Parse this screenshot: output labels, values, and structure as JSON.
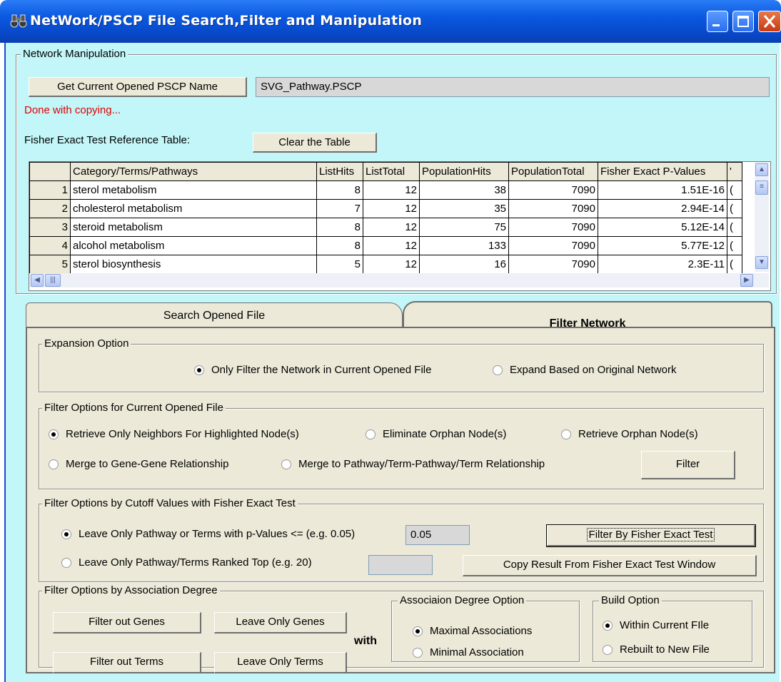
{
  "window": {
    "title": "NetWork/PSCP File Search,Filter and Manipulation",
    "app_icon": "binoculars-icon"
  },
  "network_manipulation": {
    "legend": "Network Manipulation",
    "get_name_button": "Get Current Opened PSCP Name",
    "pscp_name_value": "SVG_Pathway.PSCP",
    "status_text": "Done with copying...",
    "fisher_table_label": "Fisher Exact Test Reference Table:",
    "clear_table_button": "Clear the Table"
  },
  "fisher_table": {
    "columns": [
      "Category/Terms/Pathways",
      "ListHits",
      "ListTotal",
      "PopulationHits",
      "PopulationTotal",
      "Fisher Exact P-Values",
      "'"
    ],
    "rows": [
      {
        "index": "1",
        "term": "sterol metabolism",
        "list_hits": "8",
        "list_total": "12",
        "pop_hits": "38",
        "pop_total": "7090",
        "p_value": "1.51E-16",
        "extra": "("
      },
      {
        "index": "2",
        "term": "cholesterol metabolism",
        "list_hits": "7",
        "list_total": "12",
        "pop_hits": "35",
        "pop_total": "7090",
        "p_value": "2.94E-14",
        "extra": "("
      },
      {
        "index": "3",
        "term": "steroid metabolism",
        "list_hits": "8",
        "list_total": "12",
        "pop_hits": "75",
        "pop_total": "7090",
        "p_value": "5.12E-14",
        "extra": "("
      },
      {
        "index": "4",
        "term": "alcohol metabolism",
        "list_hits": "8",
        "list_total": "12",
        "pop_hits": "133",
        "pop_total": "7090",
        "p_value": "5.77E-12",
        "extra": "("
      },
      {
        "index": "5",
        "term": "sterol biosynthesis",
        "list_hits": "5",
        "list_total": "12",
        "pop_hits": "16",
        "pop_total": "7090",
        "p_value": "2.3E-11",
        "extra": "("
      }
    ]
  },
  "tabs": {
    "search": "Search Opened File",
    "filter": "Filter Network"
  },
  "expansion": {
    "legend": "Expansion Option",
    "only_filter": "Only Filter the Network in Current Opened File",
    "expand_original": "Expand Based on  Original Network"
  },
  "filter_current": {
    "legend": "Filter Options for Current Opened File",
    "retrieve_neighbors": "Retrieve Only Neighbors For Highlighted Node(s)",
    "eliminate_orphan": "Eliminate Orphan Node(s)",
    "retrieve_orphan": "Retrieve Orphan Node(s)",
    "merge_gene": "Merge to Gene-Gene Relationship",
    "merge_pathway": "Merge to Pathway/Term-Pathway/Term Relationship",
    "filter_button": "Filter"
  },
  "fisher_cutoff": {
    "legend": "Filter Options by Cutoff Values with Fisher Exact Test",
    "pvalue_label": "Leave Only Pathway or Terms with p-Values <= (e.g. 0.05)",
    "pvalue_value": "0.05",
    "ranked_label": "Leave Only Pathway/Terms Ranked Top (e.g. 20)",
    "ranked_value": "",
    "filter_fisher_button": "Filter By Fisher Exact Test",
    "copy_result_button": "Copy Result  From Fisher Exact Test Window"
  },
  "association": {
    "legend": "Filter Options by Association Degree",
    "filter_out_genes": "Filter out Genes",
    "leave_only_genes": "Leave Only Genes",
    "filter_out_terms": "Filter out Terms",
    "leave_only_terms": "Leave Only Terms",
    "with_label": "with",
    "degree_legend": "Associaion Degree Option",
    "maximal": "Maximal Associations",
    "minimal": "Minimal Association",
    "build_legend": "Build Option",
    "within_current": "Within Current FIle",
    "rebuilt_new": "Rebuilt to New File"
  },
  "colors": {
    "client_bg": "#c2f6f8",
    "titlebar": "#0a58e0",
    "status_red": "#e00000"
  }
}
